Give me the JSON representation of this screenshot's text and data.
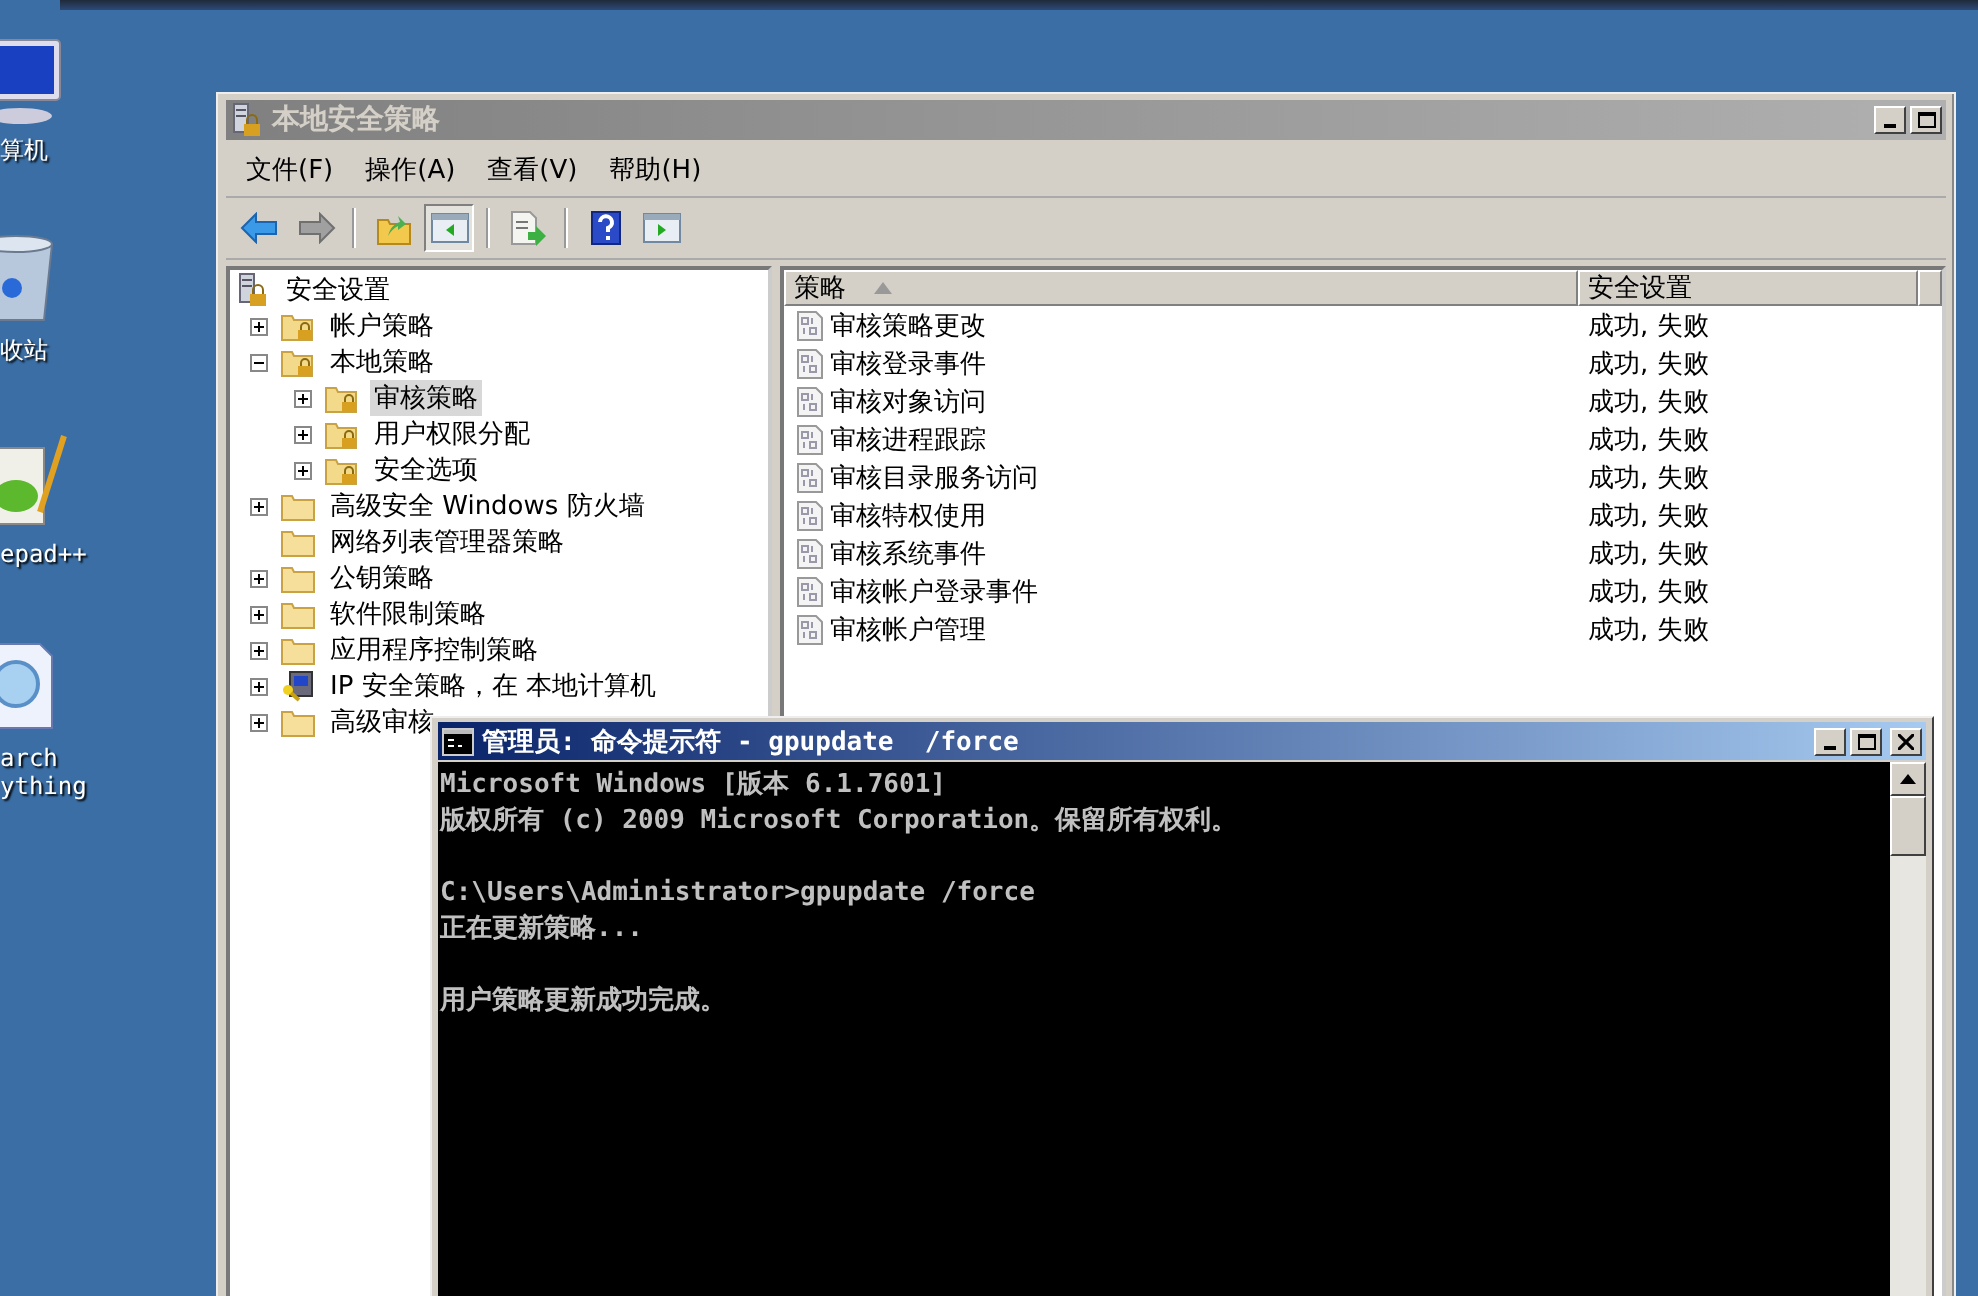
{
  "desktop_icons": [
    {
      "kind": "computer",
      "label_lines": [
        "算机"
      ]
    },
    {
      "kind": "recycle-bin",
      "label_lines": [
        "收站"
      ]
    },
    {
      "kind": "notepad",
      "label_lines": [
        "epad++"
      ]
    },
    {
      "kind": "search",
      "label_lines": [
        "arch",
        "ything"
      ]
    }
  ],
  "mmc_window": {
    "title": "本地安全策略",
    "active": false,
    "menu": [
      "文件(F)",
      "操作(A)",
      "查看(V)",
      "帮助(H)"
    ],
    "toolbar": [
      {
        "kind": "back",
        "pressed": false
      },
      {
        "kind": "forward",
        "pressed": false
      },
      {
        "kind": "sep"
      },
      {
        "kind": "up",
        "pressed": false
      },
      {
        "kind": "tree-pane",
        "pressed": true
      },
      {
        "kind": "sep"
      },
      {
        "kind": "export",
        "pressed": false
      },
      {
        "kind": "sep"
      },
      {
        "kind": "help",
        "pressed": false
      },
      {
        "kind": "action-pane",
        "pressed": false
      }
    ],
    "tree": [
      {
        "label": "安全设置",
        "kind": "root",
        "selected": false,
        "children": [
          {
            "label": "帐户策略",
            "kind": "locked-folder",
            "expanded": false,
            "selected": false
          },
          {
            "label": "本地策略",
            "kind": "locked-folder",
            "expanded": true,
            "selected": false,
            "children": [
              {
                "label": "审核策略",
                "kind": "locked-folder",
                "expanded": false,
                "selected": true
              },
              {
                "label": "用户权限分配",
                "kind": "locked-folder",
                "expanded": false,
                "selected": false
              },
              {
                "label": "安全选项",
                "kind": "locked-folder",
                "expanded": false,
                "selected": false
              }
            ]
          },
          {
            "label": "高级安全 Windows 防火墙",
            "kind": "folder",
            "expanded": false,
            "selected": false
          },
          {
            "label": "网络列表管理器策略",
            "kind": "folder",
            "selected": false
          },
          {
            "label": "公钥策略",
            "kind": "folder",
            "expanded": false,
            "selected": false
          },
          {
            "label": "软件限制策略",
            "kind": "folder",
            "expanded": false,
            "selected": false
          },
          {
            "label": "应用程序控制策略",
            "kind": "folder",
            "expanded": false,
            "selected": false
          },
          {
            "label": "IP 安全策略，在 本地计算机",
            "kind": "computer-key",
            "expanded": false,
            "selected": false
          },
          {
            "label": "高级审核",
            "kind": "folder",
            "expanded": false,
            "selected": false
          }
        ]
      }
    ],
    "list": {
      "columns": [
        {
          "label": "策略",
          "sort_ascending": true
        },
        {
          "label": "安全设置",
          "sort_ascending": false
        }
      ],
      "rows": [
        {
          "policy": "审核策略更改",
          "setting": "成功, 失败"
        },
        {
          "policy": "审核登录事件",
          "setting": "成功, 失败"
        },
        {
          "policy": "审核对象访问",
          "setting": "成功, 失败"
        },
        {
          "policy": "审核进程跟踪",
          "setting": "成功, 失败"
        },
        {
          "policy": "审核目录服务访问",
          "setting": "成功, 失败"
        },
        {
          "policy": "审核特权使用",
          "setting": "成功, 失败"
        },
        {
          "policy": "审核系统事件",
          "setting": "成功, 失败"
        },
        {
          "policy": "审核帐户登录事件",
          "setting": "成功, 失败"
        },
        {
          "policy": "审核帐户管理",
          "setting": "成功, 失败"
        }
      ]
    }
  },
  "cmd_window": {
    "title": "管理员: 命令提示符 - gpupdate  /force",
    "active": true,
    "output_blocks": [
      [
        "Microsoft Windows [版本 6.1.7601]",
        "版权所有 (c) 2009 Microsoft Corporation。保留所有权利。"
      ],
      [
        "C:\\Users\\Administrator>gpupdate /force",
        "正在更新策略..."
      ],
      [
        "用户策略更新成功完成。"
      ]
    ]
  }
}
